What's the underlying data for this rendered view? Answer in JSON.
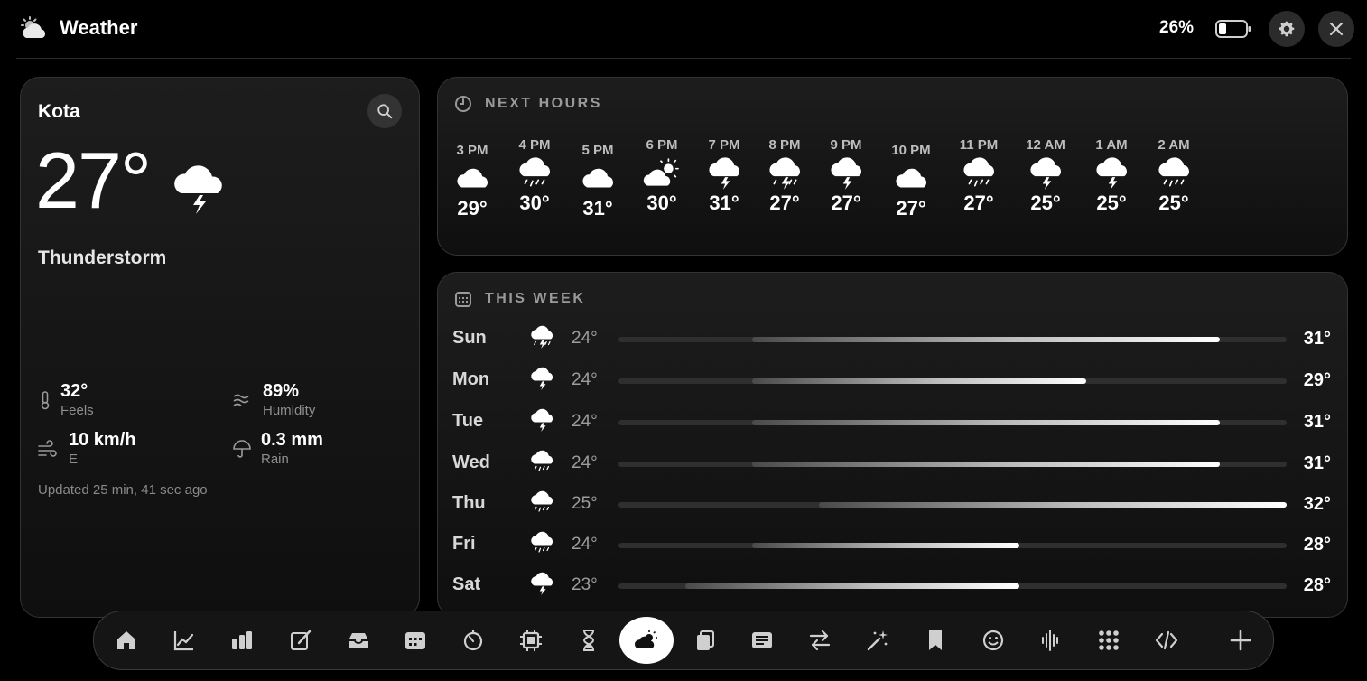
{
  "app": {
    "title": "Weather",
    "battery": "26%",
    "icons": {
      "app": "cloud-sun-icon",
      "battery": "battery-icon",
      "settings": "gear-icon",
      "close": "close-icon"
    }
  },
  "current": {
    "city": "Kota",
    "temp": "27°",
    "condition": "Thunderstorm",
    "icon": "thunder-cloud-icon",
    "feels": {
      "value": "32°",
      "label": "Feels"
    },
    "humidity": {
      "value": "89%",
      "label": "Humidity"
    },
    "wind": {
      "value": "10 km/h",
      "label": "E"
    },
    "rain": {
      "value": "0.3 mm",
      "label": "Rain"
    },
    "updated": "Updated 25 min, 41 sec ago"
  },
  "hourly": {
    "title": "NEXT HOURS",
    "items": [
      {
        "time": "3 PM",
        "temp": "29°",
        "icon": "cloud"
      },
      {
        "time": "4 PM",
        "temp": "30°",
        "icon": "rain"
      },
      {
        "time": "5 PM",
        "temp": "31°",
        "icon": "cloud"
      },
      {
        "time": "6 PM",
        "temp": "30°",
        "icon": "sun-cloud"
      },
      {
        "time": "7 PM",
        "temp": "31°",
        "icon": "thunder"
      },
      {
        "time": "8 PM",
        "temp": "27°",
        "icon": "thunder-rain"
      },
      {
        "time": "9 PM",
        "temp": "27°",
        "icon": "thunder"
      },
      {
        "time": "10 PM",
        "temp": "27°",
        "icon": "cloud"
      },
      {
        "time": "11 PM",
        "temp": "27°",
        "icon": "rain"
      },
      {
        "time": "12 AM",
        "temp": "25°",
        "icon": "thunder"
      },
      {
        "time": "1 AM",
        "temp": "25°",
        "icon": "thunder"
      },
      {
        "time": "2 AM",
        "temp": "25°",
        "icon": "rain"
      }
    ]
  },
  "weekly": {
    "title": "THIS WEEK",
    "days": [
      {
        "day": "Sun",
        "lo": "24°",
        "hi": "31°",
        "lo_n": 24,
        "hi_n": 31,
        "icon": "thunder-rain"
      },
      {
        "day": "Mon",
        "lo": "24°",
        "hi": "29°",
        "lo_n": 24,
        "hi_n": 29,
        "icon": "thunder"
      },
      {
        "day": "Tue",
        "lo": "24°",
        "hi": "31°",
        "lo_n": 24,
        "hi_n": 31,
        "icon": "thunder"
      },
      {
        "day": "Wed",
        "lo": "24°",
        "hi": "31°",
        "lo_n": 24,
        "hi_n": 31,
        "icon": "rain"
      },
      {
        "day": "Thu",
        "lo": "25°",
        "hi": "32°",
        "lo_n": 25,
        "hi_n": 32,
        "icon": "rain"
      },
      {
        "day": "Fri",
        "lo": "24°",
        "hi": "28°",
        "lo_n": 24,
        "hi_n": 28,
        "icon": "rain"
      },
      {
        "day": "Sat",
        "lo": "23°",
        "hi": "28°",
        "lo_n": 23,
        "hi_n": 28,
        "icon": "thunder"
      }
    ],
    "range": [
      22,
      32
    ]
  },
  "dock": {
    "items": [
      "home-icon",
      "chart-line-icon",
      "bar-chart-icon",
      "edit-icon",
      "inbox-icon",
      "calendar-icon",
      "timer-icon",
      "cpu-icon",
      "hourglass-icon",
      "weather-icon",
      "clipboard-icon",
      "notes-icon",
      "transfer-icon",
      "magic-icon",
      "bookmark-icon",
      "emoji-icon",
      "waveform-icon",
      "apps-grid-icon",
      "code-icon",
      "add-icon"
    ],
    "active": "weather-icon"
  }
}
